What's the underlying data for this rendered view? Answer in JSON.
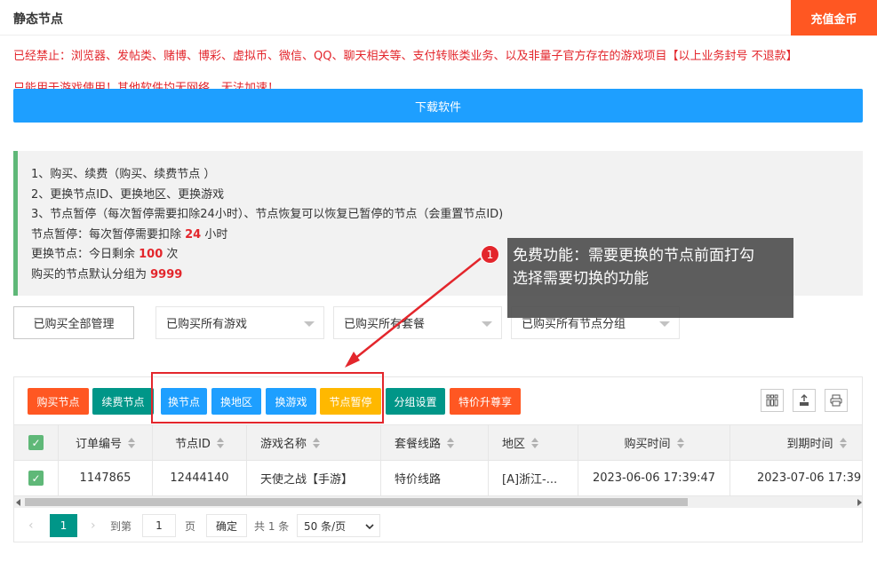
{
  "header": {
    "title": "静态节点",
    "recharge_label": "充值金币"
  },
  "notice": {
    "banned": "已经禁止：浏览器、发帖类、赌博、博彩、虚拟币、微信、QQ、聊天相关等、支付转账类业务、以及非量子官方存在的游戏项目【以上业务封号 不退款】",
    "second_line_partial": "只能用于游戏使用！其他软件均无网络，无法加速！"
  },
  "download_label": "下载软件",
  "info": {
    "line1": "1、购买、续费（购买、续费节点 ）",
    "line2": "2、更换节点ID、更换地区、更换游戏",
    "line3": "3、节点暂停（每次暂停需要扣除24小时）、节点恢复可以恢复已暂停的节点（会重置节点ID)",
    "pause_prefix": "节点暂停：每次暂停需要扣除 ",
    "pause_value": "24",
    "pause_suffix": " 小时",
    "change_prefix": "更换节点：今日剩余 ",
    "change_value": "100",
    "change_suffix": " 次",
    "group_prefix": "购买的节点默认分组为 ",
    "group_value": "9999"
  },
  "filters": {
    "manage_label": "已购买全部管理",
    "game_select": "已购买所有游戏",
    "package_select": "已购买所有套餐",
    "group_select": "已购买所有节点分组"
  },
  "toolbar": {
    "buttons": [
      {
        "label": "购买节点",
        "color": "#ff5722"
      },
      {
        "label": "续费节点",
        "color": "#009688"
      },
      {
        "label": "换节点",
        "color": "#1e9fff"
      },
      {
        "label": "换地区",
        "color": "#1e9fff"
      },
      {
        "label": "换游戏",
        "color": "#1e9fff"
      },
      {
        "label": "节点暂停",
        "color": "#ffb800"
      },
      {
        "label": "分组设置",
        "color": "#009688"
      },
      {
        "label": "特价升尊享",
        "color": "#ff5722"
      }
    ],
    "icons": [
      "columns-icon",
      "export-icon",
      "print-icon"
    ]
  },
  "table": {
    "columns": [
      "订单编号",
      "节点ID",
      "游戏名称",
      "套餐线路",
      "地区",
      "购买时间",
      "到期时间"
    ],
    "rows": [
      {
        "order_no": "1147865",
        "node_id": "12444140",
        "game": "天使之战【手游】",
        "package": "特价线路",
        "region": "[A]浙江-...",
        "buy_time": "2023-06-06 17:39:47",
        "expire_time": "2023-07-06 17:39:47"
      }
    ]
  },
  "pagination": {
    "current_page": "1",
    "goto_label": "到第",
    "page_input": "1",
    "page_unit": "页",
    "confirm_label": "确定",
    "total": "共 1 条",
    "page_size": "50 条/页"
  },
  "tooltip": {
    "badge": "1",
    "line1": "免费功能：需要更换的节点前面打勾",
    "line2": "选择需要切换的功能"
  },
  "colors": {
    "accent_orange": "#ff5722",
    "accent_blue": "#1e9fff",
    "accent_green": "#009688",
    "highlight_red": "#e3262c"
  }
}
